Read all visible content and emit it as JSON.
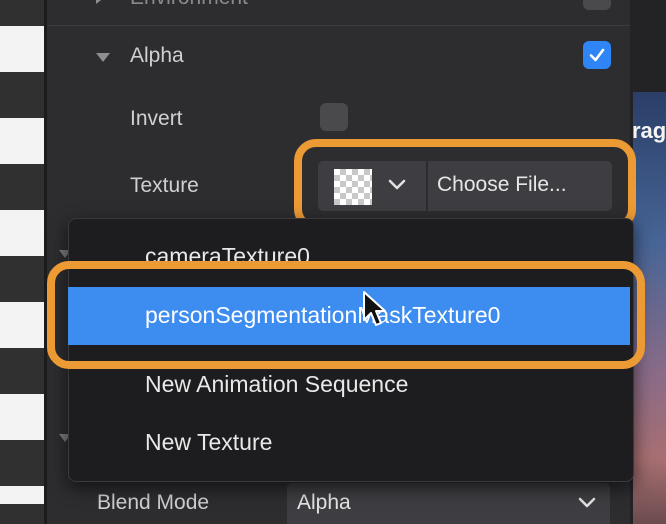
{
  "panel": {
    "environment_label": "Environment",
    "alpha_label": "Alpha",
    "alpha_checked": true,
    "invert_label": "Invert",
    "invert_checked": false,
    "texture_label": "Texture",
    "choose_file_label": "Choose File...",
    "blend_mode_label": "Blend Mode",
    "blend_mode_value": "Alpha"
  },
  "texture_menu": {
    "items": [
      {
        "label": "cameraTexture0",
        "selected": false
      },
      {
        "label": "personSegmentationMaskTexture0",
        "selected": true
      },
      {
        "label": "New Animation Sequence",
        "selected": false
      },
      {
        "label": "New Texture",
        "selected": false
      }
    ]
  },
  "preview": {
    "partial_text": "rag"
  },
  "colors": {
    "accent": "#2f84f6",
    "selection": "#3d8cf0",
    "highlight_ring": "#ec9a34",
    "panel_bg": "#2d2d30"
  },
  "icons": {
    "checkbox_check": "checkmark-icon",
    "texture_dropdown": "chevron-down-icon",
    "blend_dropdown": "chevron-down-icon",
    "cursor": "mouse-pointer-icon"
  }
}
